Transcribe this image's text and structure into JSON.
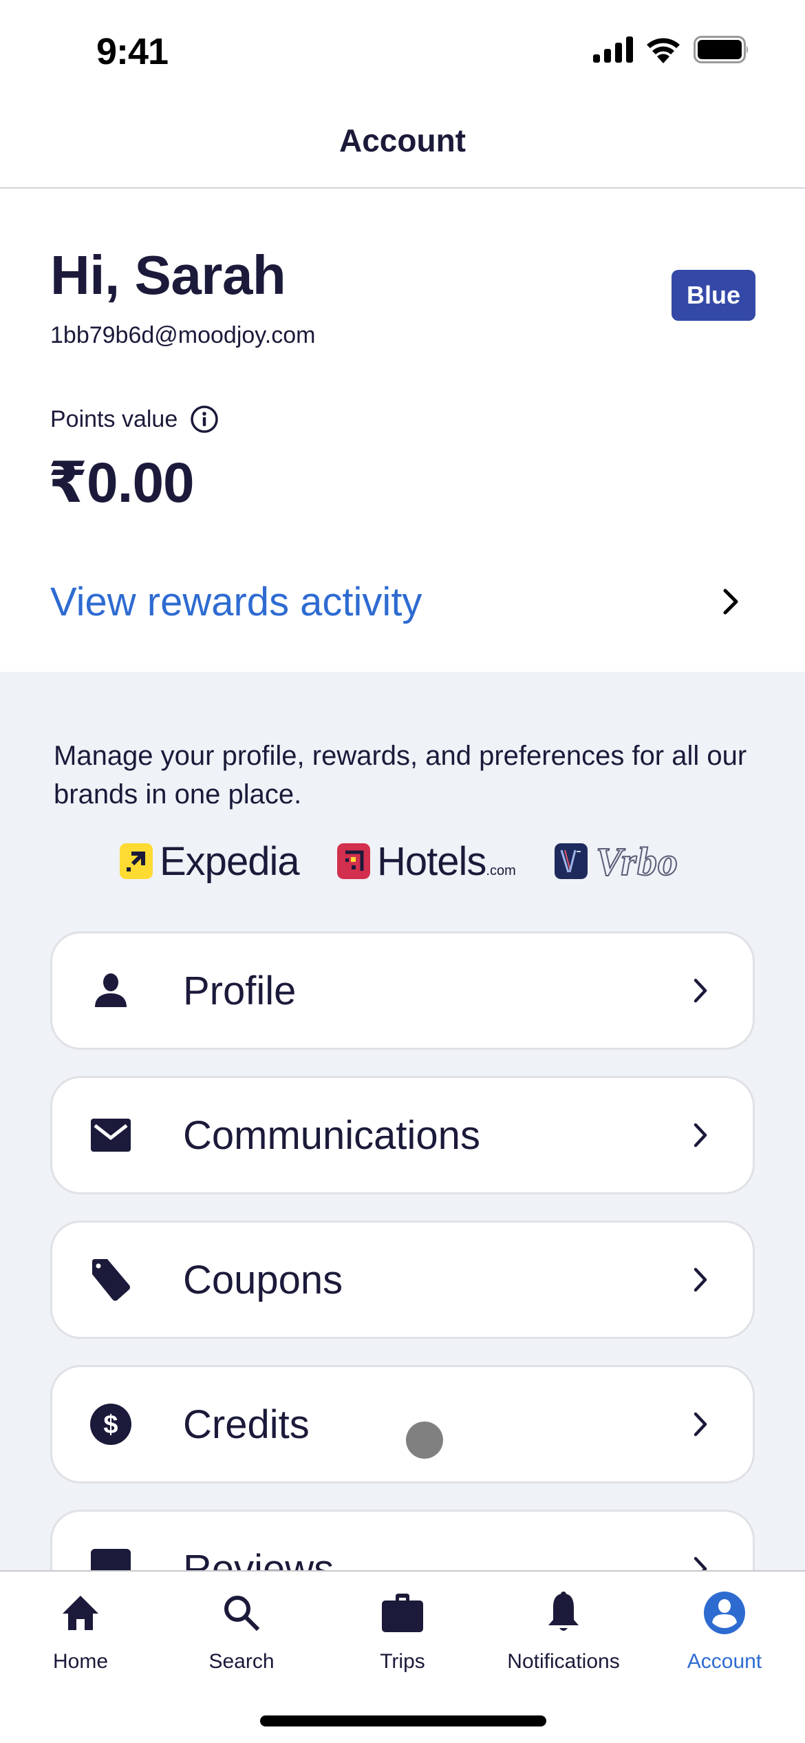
{
  "status_bar": {
    "time": "9:41",
    "icons": [
      "cellular-signal-icon",
      "wifi-icon",
      "battery-icon"
    ]
  },
  "header": {
    "title": "Account"
  },
  "summary": {
    "greeting": "Hi, Sarah",
    "email": "1bb79b6d@moodjoy.com",
    "tier_badge": "Blue",
    "points_label": "Points value",
    "points_info_icon": "info-icon",
    "points_value": "₹0.00",
    "rewards_link": "View rewards activity"
  },
  "description": "Manage your profile, rewards, and preferences for all our brands in one place.",
  "brands": [
    {
      "name": "Expedia",
      "suffix": "",
      "color": "#fddb32"
    },
    {
      "name": "Hotels",
      "suffix": ".com",
      "color": "#d32f4e"
    },
    {
      "name": "Vrbo",
      "suffix": "",
      "color": "#1f2a5c"
    }
  ],
  "menu": [
    {
      "label": "Profile",
      "icon": "person-icon"
    },
    {
      "label": "Communications",
      "icon": "envelope-icon"
    },
    {
      "label": "Coupons",
      "icon": "tag-icon"
    },
    {
      "label": "Credits",
      "icon": "dollar-circle-icon"
    },
    {
      "label": "Reviews",
      "icon": "reviews-icon"
    }
  ],
  "tabbar": {
    "tabs": [
      {
        "label": "Home",
        "icon": "home-icon",
        "active": false
      },
      {
        "label": "Search",
        "icon": "search-icon",
        "active": false
      },
      {
        "label": "Trips",
        "icon": "briefcase-icon",
        "active": false
      },
      {
        "label": "Notifications",
        "icon": "bell-icon",
        "active": false
      },
      {
        "label": "Account",
        "icon": "account-circle-icon",
        "active": true
      }
    ]
  },
  "colors": {
    "text_primary": "#1b1a3a",
    "link_blue": "#2e6bd1",
    "tier_blue": "#3449a7",
    "page_background": "#eff2f7"
  }
}
